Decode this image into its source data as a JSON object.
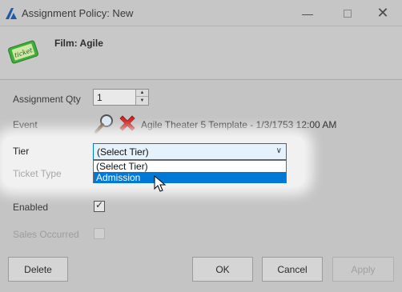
{
  "window": {
    "title": "Assignment Policy: New",
    "minimize": "—",
    "close": "✕"
  },
  "header": {
    "film_title": "Film: Agile",
    "icon_text": "ticket"
  },
  "form": {
    "assignment_qty": {
      "label": "Assignment Qty",
      "value": "1"
    },
    "event": {
      "label": "Event",
      "value": "Agile Theater 5 Template - 1/3/1753 12:00 AM"
    },
    "tier": {
      "label": "Tier",
      "selected": "(Select Tier)",
      "options": [
        "(Select Tier)",
        "Admission"
      ],
      "highlighted": "Admission"
    },
    "ticket_type": {
      "label": "Ticket Type"
    },
    "enabled": {
      "label": "Enabled",
      "checked": true,
      "mark": "✓"
    },
    "sales_occurred": {
      "label": "Sales Occurred",
      "checked": false
    }
  },
  "buttons": {
    "delete": "Delete",
    "ok": "OK",
    "cancel": "Cancel",
    "apply": "Apply"
  },
  "colors": {
    "selection": "#0078d7",
    "delete_x": "#d21f1f"
  }
}
